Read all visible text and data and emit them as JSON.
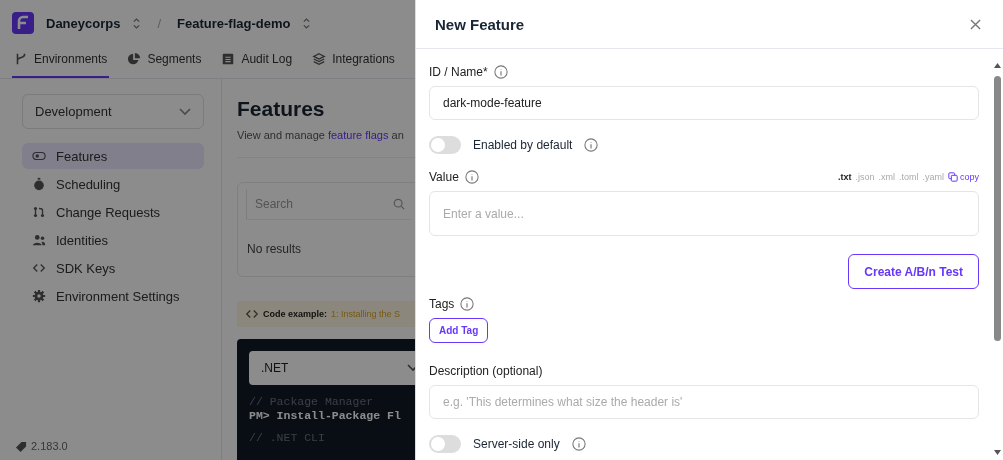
{
  "topbar": {
    "organization": "Daneycorps",
    "separator": "/",
    "project": "Feature-flag-demo"
  },
  "tabs": [
    {
      "label": "Environments",
      "selected": true
    },
    {
      "label": "Segments",
      "selected": false
    },
    {
      "label": "Audit Log",
      "selected": false
    },
    {
      "label": "Integrations",
      "selected": false
    }
  ],
  "environment_select": {
    "value": "Development"
  },
  "sidebar": {
    "items": [
      {
        "label": "Features",
        "selected": true
      },
      {
        "label": "Scheduling",
        "selected": false
      },
      {
        "label": "Change Requests",
        "selected": false
      },
      {
        "label": "Identities",
        "selected": false
      },
      {
        "label": "SDK Keys",
        "selected": false
      },
      {
        "label": "Environment Settings",
        "selected": false
      }
    ],
    "version": "2.183.0"
  },
  "main": {
    "title": "Features",
    "subtitle": [
      {
        "kind": "text",
        "text": "View and manage "
      },
      {
        "kind": "link",
        "text": "feature flags"
      },
      {
        "kind": "text",
        "text": " an"
      }
    ],
    "search": {
      "placeholder": "Search"
    },
    "empty_text": "No results",
    "code_example": {
      "label": "Code example:",
      "step": "1: Installing the S"
    },
    "code": {
      "language": ".NET",
      "lines": [
        {
          "kind": "comment",
          "text": "// Package Manager"
        },
        {
          "kind": "command",
          "text": "PM> Install-Package Fl"
        },
        {
          "kind": "comment",
          "text": "// .NET CLI"
        }
      ]
    }
  },
  "drawer": {
    "title": "New Feature",
    "id_field": {
      "label": "ID / Name*",
      "value": "dark-mode-feature"
    },
    "enabled_toggle": {
      "label": "Enabled by default",
      "on": false
    },
    "value_field": {
      "label": "Value",
      "formats": [
        {
          "label": ".txt",
          "selected": true
        },
        {
          "label": ".json",
          "selected": false
        },
        {
          "label": ".xml",
          "selected": false
        },
        {
          "label": ".toml",
          "selected": false
        },
        {
          "label": ".yaml",
          "selected": false
        }
      ],
      "copy": "copy",
      "placeholder": "Enter a value..."
    },
    "ab_button": "Create A/B/n Test",
    "tags": {
      "label": "Tags",
      "button": "Add Tag"
    },
    "description_field": {
      "label": "Description (optional)",
      "placeholder": "e.g. 'This determines what size the header is'"
    },
    "server_toggle": {
      "label": "Server-side only",
      "on": false
    }
  }
}
